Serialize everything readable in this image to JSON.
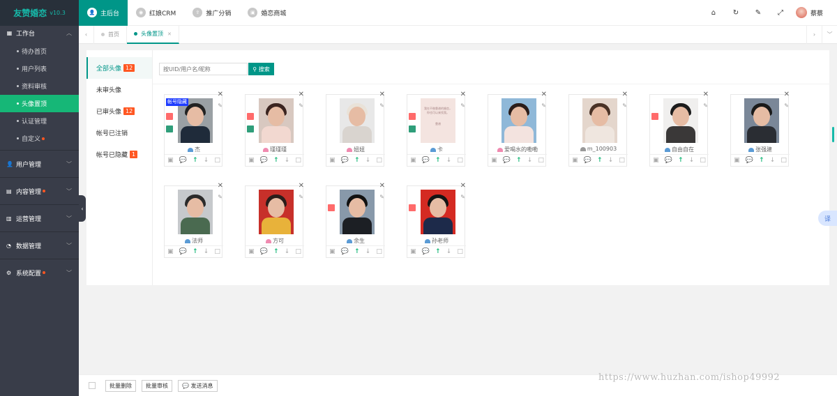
{
  "app": {
    "title": "友赞婚恋",
    "version": "v10.3"
  },
  "sidebar": {
    "top": {
      "label": "工作台",
      "icon": "grid-icon"
    },
    "sub_items": [
      {
        "label": "待办首页"
      },
      {
        "label": "用户列表"
      },
      {
        "label": "资料审核"
      },
      {
        "label": "头像置顶",
        "active": true
      },
      {
        "label": "认证管理"
      },
      {
        "label": "自定义",
        "dot": true
      }
    ],
    "groups": [
      {
        "label": "用户管理",
        "icon": "user-icon"
      },
      {
        "label": "内容管理",
        "icon": "content-icon",
        "dot": true
      },
      {
        "label": "运营管理",
        "icon": "operations-icon"
      },
      {
        "label": "数据管理",
        "icon": "pie-icon"
      },
      {
        "label": "系统配置",
        "icon": "gear-icon",
        "dot": true
      }
    ]
  },
  "topnav": [
    {
      "label": "主后台",
      "active": true
    },
    {
      "label": "红娘CRM"
    },
    {
      "label": "推广分销"
    },
    {
      "label": "婚恋商城"
    }
  ],
  "user": {
    "name": "蔡蔡"
  },
  "tabs": [
    {
      "label": "首页"
    },
    {
      "label": "头像置顶",
      "active": true
    }
  ],
  "filters": [
    {
      "label": "全部头像",
      "count": "12",
      "active": true
    },
    {
      "label": "未审头像"
    },
    {
      "label": "已审头像",
      "count": "12"
    },
    {
      "label": "帐号已注销"
    },
    {
      "label": "帐号已隐藏",
      "count": "1"
    }
  ],
  "search": {
    "placeholder": "按UID/用户名/昵称",
    "button": "搜索"
  },
  "cards": [
    {
      "name": "杰",
      "gender": "male",
      "hidden": "帐号隐藏",
      "red": true,
      "green": true,
      "bg": "#9aa0a4",
      "body": "#1f2b3a",
      "hair": "#222"
    },
    {
      "name": "瑾瑾瑾",
      "gender": "female",
      "red": true,
      "green": true,
      "bg": "#d8c8c0",
      "body": "#f2d8d0",
      "hair": "#3b2420"
    },
    {
      "name": "妞妞",
      "gender": "female",
      "bg": "#e8e8e8",
      "body": "#d9d4cf",
      "hair": "#e9e2d8"
    },
    {
      "name": "卡",
      "gender": "male",
      "red": true,
      "green": true,
      "bg": "#f4e4e0",
      "body": "#f4e4e0",
      "hair": "#f4e4e0",
      "text_photo": true
    },
    {
      "name": "爱喝水的嘞嘞",
      "gender": "female",
      "bg": "#8fb8d8",
      "body": "#f3e3df",
      "hair": "#2b1d1a"
    },
    {
      "name": "m_100903",
      "gender": "unknown",
      "bg": "#e4d6cc",
      "body": "#efe6df",
      "hair": "#4a3226"
    },
    {
      "name": "自由自在",
      "gender": "male",
      "red": true,
      "bg": "#f0efee",
      "body": "#3a3838",
      "hair": "#1c1c1c"
    },
    {
      "name": "张强建",
      "gender": "male",
      "bg": "#7a8798",
      "body": "#2a2d33",
      "hair": "#1a1a1a"
    },
    {
      "name": "法师",
      "gender": "male",
      "bg": "#c6c9cc",
      "body": "#4a6a50",
      "hair": "#2b2b2b"
    },
    {
      "name": "方可",
      "gender": "female",
      "bg": "#c7302a",
      "body": "#e8b23a",
      "hair": "#2b1d1a"
    },
    {
      "name": "余生",
      "gender": "male",
      "red": true,
      "bg": "#8899aa",
      "body": "#1c1f24",
      "hair": "#111"
    },
    {
      "name": "孙老师",
      "gender": "male",
      "red": true,
      "bg": "#d42a22",
      "body": "#1d2a4a",
      "hair": "#141414"
    }
  ],
  "card_photo_text": "我在不做靠谱的婚恋，你也可以来找我。",
  "card_photo_small": "靠谱",
  "actions": [
    "▣",
    "💬",
    "↑",
    "↓",
    "□"
  ],
  "bottom": {
    "delete": "批量删除",
    "review": "批量审核",
    "message": "发送消息"
  },
  "watermark": "https://www.huzhan.com/ishop49992",
  "translate": "译",
  "colors": {
    "primary": "#009688",
    "active_green": "#16b777",
    "badge": "#ff5722",
    "sidebar": "#393d49"
  }
}
